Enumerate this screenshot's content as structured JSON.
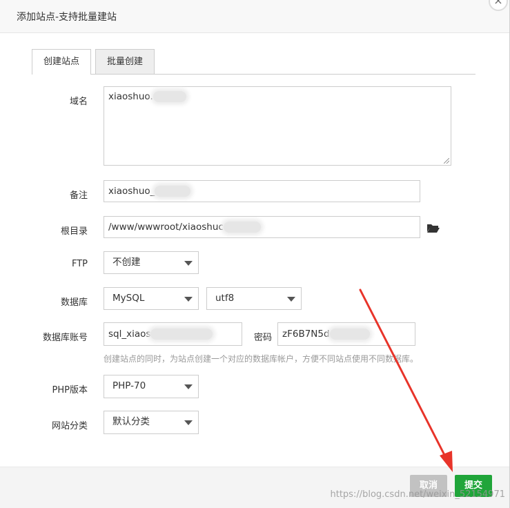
{
  "dialog": {
    "title": "添加站点-支持批量建站",
    "close_glyph": "×"
  },
  "tabs": [
    {
      "label": "创建站点",
      "active": true
    },
    {
      "label": "批量创建",
      "active": false
    }
  ],
  "form": {
    "domain": {
      "label": "域名",
      "value": "xiaoshuo."
    },
    "remark": {
      "label": "备注",
      "value": "xiaoshuo_"
    },
    "root": {
      "label": "根目录",
      "value": "/www/wwwroot/xiaoshuc",
      "icon": "folder-open-icon"
    },
    "ftp": {
      "label": "FTP",
      "selected": "不创建"
    },
    "database": {
      "label": "数据库",
      "type_selected": "MySQL",
      "charset_selected": "utf8"
    },
    "db_account": {
      "label": "数据库账号",
      "value": "sql_xiaos",
      "password_label": "密码",
      "password_value": "zF6B7N5d"
    },
    "db_hint": "创建站点的同时，为站点创建一个对应的数据库帐户，方便不同站点使用不同数据库。",
    "php": {
      "label": "PHP版本",
      "selected": "PHP-70"
    },
    "category": {
      "label": "网站分类",
      "selected": "默认分类"
    }
  },
  "footer": {
    "cancel_label": "取消",
    "submit_label": "提交",
    "cancel_color": "#c2c2c2",
    "submit_color": "#20a53a"
  },
  "watermark": "https://blog.csdn.net/weixin_52154971",
  "annotation_color": "#e8342a"
}
